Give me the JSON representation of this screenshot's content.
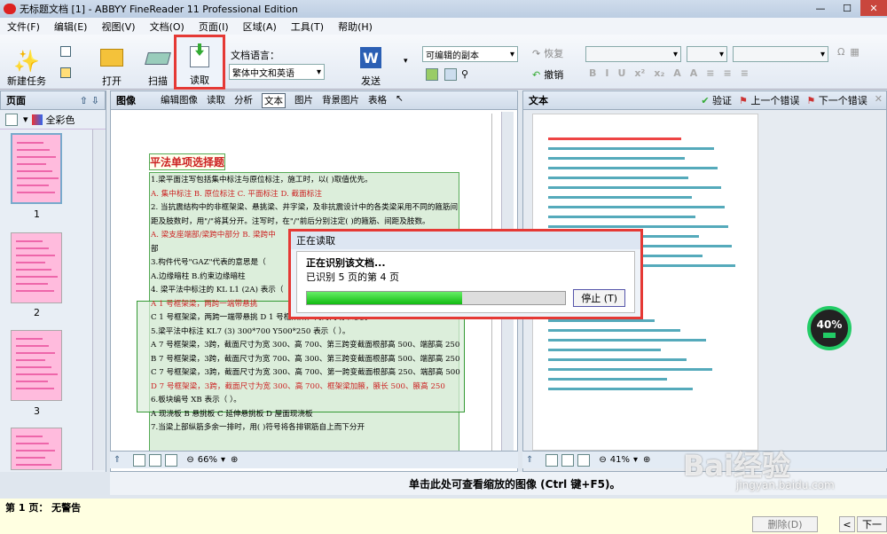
{
  "window": {
    "title": "无标题文档 [1] - ABBYY FineReader 11 Professional Edition"
  },
  "menu": [
    "文件(F)",
    "编辑(E)",
    "视图(V)",
    "文档(O)",
    "页面(I)",
    "区域(A)",
    "工具(T)",
    "帮助(H)"
  ],
  "toolbar": {
    "new_task": "新建任务",
    "open": "打开",
    "scan": "扫描",
    "read": "读取",
    "lang_label": "文档语言：",
    "lang_value": "繁体中文和英语",
    "send": "发送",
    "format_value": "可编辑的副本",
    "redo": "恢复",
    "undo": "撤销"
  },
  "pages_pane": {
    "title": "页面",
    "color": "全彩色",
    "thumb_labels": [
      "1",
      "2",
      "3"
    ]
  },
  "image_pane": {
    "title": "图像",
    "tools": [
      "编辑图像",
      "读取",
      "分析",
      "文本",
      "图片",
      "背景图片",
      "表格"
    ],
    "zoom": "66%"
  },
  "text_pane": {
    "title": "文本",
    "verify": "验证",
    "prev_err": "上一个错误",
    "next_err": "下一个错误",
    "zoom": "41%"
  },
  "document": {
    "heading": "平法单项选择题",
    "lines": [
      "1.梁平面注写包括集中标注与原位标注，施工时，以(  )取值优先。",
      "A. 集中标注   B. 原位标注   C. 平面标注   D. 截面标注",
      "2. 当抗震结构中的非框架梁、悬挑梁、井字梁，及非抗震设计中的各类梁采用不同的箍筋间",
      "距及肢数时，用\"/\"将其分开。注写时，在\"/\"前后分别注定(  )的箍筋、间距及肢数。",
      "A. 梁支座端部/梁跨中部分   B. 梁跨中",
      "部",
      "3.构件代号\"GAZ\"代表的意思是（",
      "A.边缘暗柱          B.约束边缘暗柱",
      "4. 梁平法中标注的 KL L1 (2A) 表示（",
      "A 1 号框架梁，两跨一端带悬挑",
      "C 1 号框架梁，两跨一端带悬挑    D 1 号框架梁，两跨两端带悬挑",
      "5.梁平法中标注 KL7 (3) 300*700 Y500*250 表示（    ）。",
      "A 7 号框架梁，3跨，截面尺寸为宽 300、高 700、第三跨变截面根部高 500、端部高 250",
      "B 7 号框架梁，3跨，截面尺寸为宽 700、高 300、第三跨变截面根部高 500、端部高 250",
      "C 7 号框架梁，3跨，截面尺寸为宽 300、高 700、第一跨变截面根部高 250、端部高 500",
      "D 7 号框架梁，3跨，截面尺寸为宽 300、高 700、框架梁加腋，腋长 500、腋高 250",
      "6.板块编号 XB 表示（       ）。",
      "A   现浇板      B 悬挑板      C 延伸悬挑板      D 屋面现浇板",
      "7.当梁上部纵筋多余一排时，用(    )符号将各排钢筋自上而下分开"
    ]
  },
  "dialog": {
    "title": "正在读取",
    "line1": "正在识别该文档...",
    "line2": "已识别 5 页的第 4 页",
    "stop": "停止 (T)",
    "progress": 0.6
  },
  "battery": {
    "percent": "40%"
  },
  "hint": "单击此处可查看缩放的图像 (Ctrl 键+F5)。",
  "status": {
    "text": "第 1 页：  无警告",
    "delete": "删除(D)",
    "next": "下一"
  },
  "watermark": {
    "brand": "Bai经验",
    "url": "jingyan.baidu.com"
  }
}
